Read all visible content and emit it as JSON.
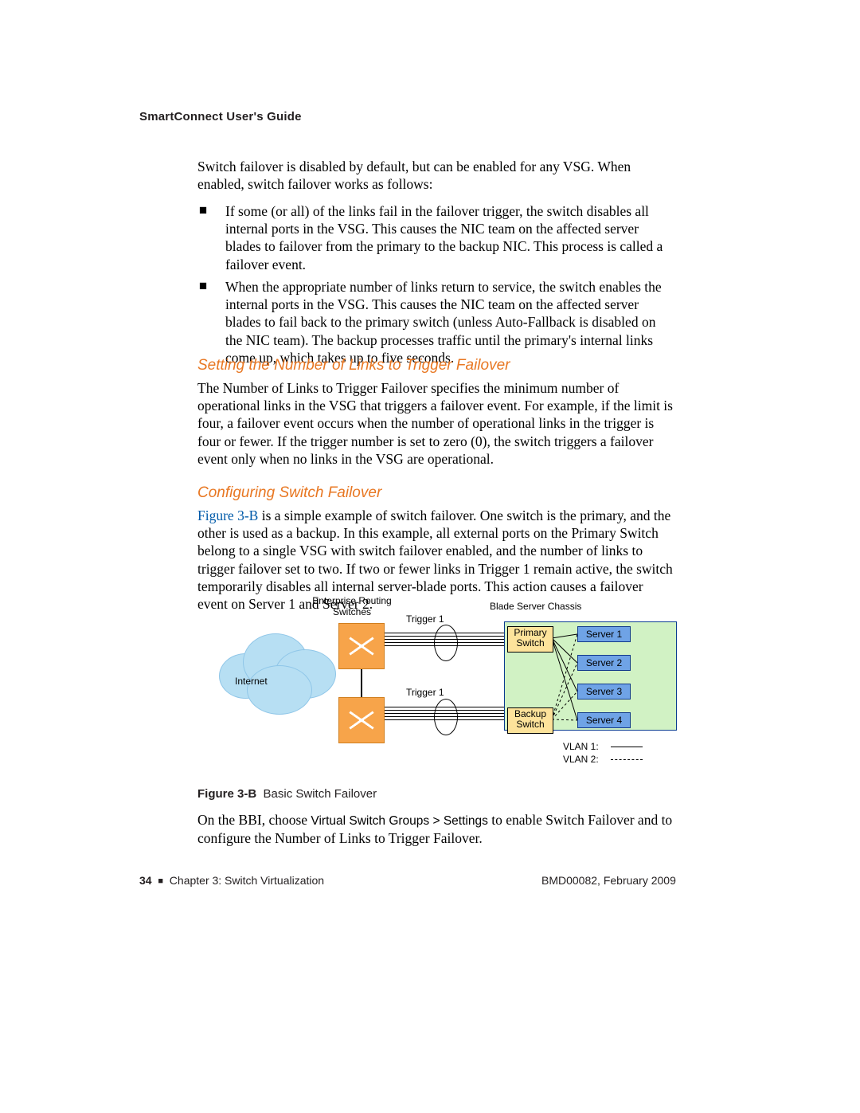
{
  "header": {
    "title": "SmartConnect User's Guide"
  },
  "intro": {
    "para": "Switch failover is disabled by default, but can be enabled for any VSG. When enabled, switch failover works as follows:",
    "bullet1": "If some (or all) of the links fail in the failover trigger, the switch disables all internal ports in the VSG. This causes the NIC team on the affected server blades to failover from the primary to the backup NIC. This process is called a failover event.",
    "bullet2": "When the appropriate number of links return to service, the switch enables the internal ports in the VSG. This causes the NIC team on the affected server blades to fail back to the primary switch (unless Auto-Fallback is disabled on the NIC team). The backup processes traffic until the primary's internal links come up, which takes up to five seconds."
  },
  "sections": {
    "setting": {
      "heading": "Setting the Number of Links to Trigger Failover",
      "body": "The Number of Links to Trigger Failover specifies the minimum number of operational links in the VSG that triggers a failover event. For example, if the limit is four, a failover event occurs when the number of operational links in the trigger is four or fewer. If the trigger number is set to zero (0), the switch triggers a failover event only when no links in the VSG are operational."
    },
    "configuring": {
      "heading": "Configuring Switch Failover",
      "link_text": "Figure 3-B",
      "body_after_link": " is a simple example of switch failover. One switch is the primary, and the other is used as a backup. In this example, all external ports on the Primary Switch belong to a single VSG with switch failover enabled, and the number of links to trigger failover set to two. If two or fewer links in Trigger 1 remain active, the switch temporarily disables all internal server-blade ports. This action causes a failover event on Server 1 and Server 2.",
      "body_below_fig_a": "On the BBI, choose ",
      "ui_path": "Virtual Switch Groups > Settings",
      "body_below_fig_b": " to enable Switch Failover and to configure the Number of Links to Trigger Failover."
    }
  },
  "figure": {
    "caption_label": "Figure 3-B",
    "caption_text": "Basic Switch Failover",
    "labels": {
      "enterprise": "Enterprise Routing Switches",
      "internet": "Internet",
      "trigger": "Trigger 1",
      "chassis": "Blade Server Chassis",
      "primary": "Primary Switch",
      "backup": "Backup Switch",
      "server1": "Server 1",
      "server2": "Server 2",
      "server3": "Server 3",
      "server4": "Server 4",
      "vlan1": "VLAN 1:",
      "vlan2": "VLAN 2:"
    }
  },
  "footer": {
    "page": "34",
    "chapter": "Chapter 3: Switch Virtualization",
    "docid": "BMD00082, February 2009"
  }
}
